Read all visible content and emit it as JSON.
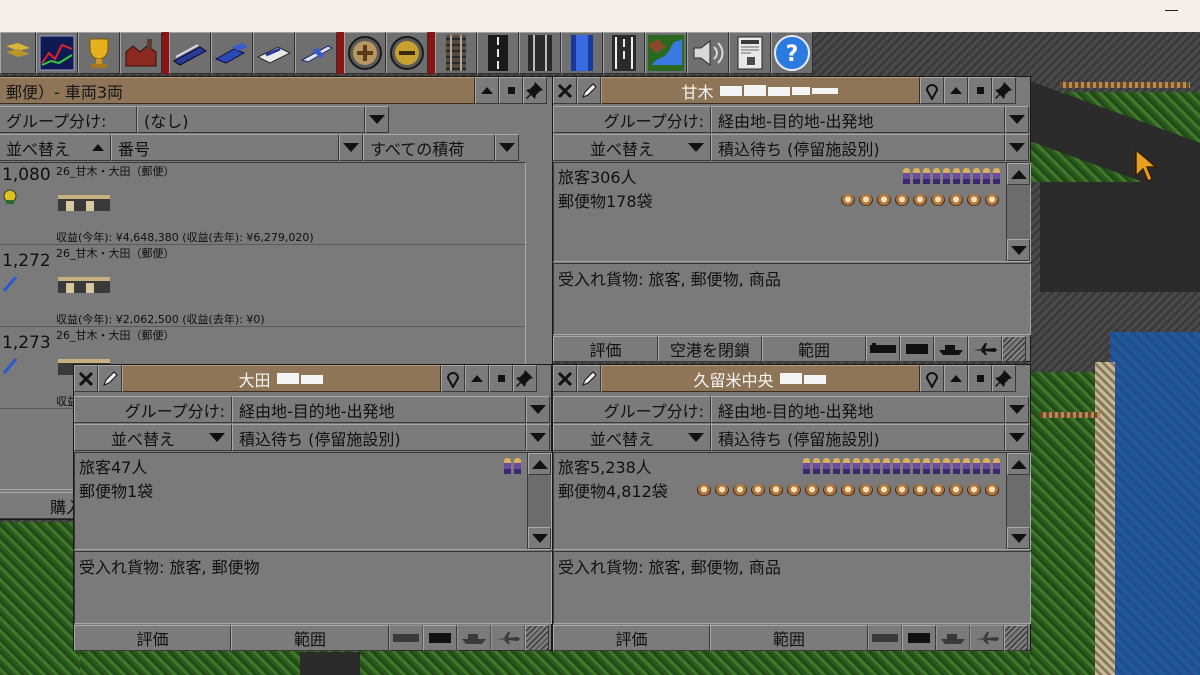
{
  "toolbar": {
    "buttons": [
      "flag-icon",
      "graph-icon",
      "trophy-icon",
      "factory-icon",
      "train-icon",
      "truck-icon",
      "ship-icon",
      "plane-icon",
      "zoom-in-icon",
      "zoom-out-icon",
      "rail-icon",
      "road-icon",
      "tram-icon",
      "water-icon",
      "airport-icon",
      "landscape-icon",
      "sound-icon",
      "newspaper-icon",
      "help-icon"
    ]
  },
  "vehicle_list_window": {
    "title": "郵便）- 車両3両",
    "group_label": "グループ分け:",
    "group_value": "(なし)",
    "sort_label": "並べ替え",
    "sort_value": "番号",
    "cargo_filter": "すべての積荷",
    "buy_button": "購入",
    "vehicles": [
      {
        "number": "1,080",
        "order": "26_甘木・大田（郵便）",
        "profit": "収益(今年): ¥4,648,380 (収益(去年): ¥6,279,020)"
      },
      {
        "number": "1,272",
        "order": "26_甘木・大田（郵便）",
        "profit": "収益(今年): ¥2,062,500 (収益(去年): ¥0)"
      },
      {
        "number": "1,273",
        "order": "26_甘木・大田（郵便）",
        "profit": "収益"
      }
    ]
  },
  "station_amagi": {
    "name": "甘木",
    "group_label": "グループ分け:",
    "group_value": "経由地-目的地-出発地",
    "sort_label": "並べ替え",
    "sort_value": "積込待ち (停留施設別)",
    "cargo": [
      {
        "text": "旅客306人",
        "icon": "passenger-icon",
        "count": 10
      },
      {
        "text": "郵便物178袋",
        "icon": "mailbag-icon",
        "count": 9
      }
    ],
    "accepts": "受入れ貨物: 旅客, 郵便物, 商品",
    "rating_button": "評価",
    "close_airport_button": "空港を閉鎖",
    "coverage_button": "範囲"
  },
  "station_ota": {
    "name": "大田",
    "group_label": "グループ分け:",
    "group_value": "経由地-目的地-出発地",
    "sort_label": "並べ替え",
    "sort_value": "積込待ち (停留施設別)",
    "cargo": [
      {
        "text": "旅客47人",
        "icon": "passenger-icon",
        "count": 2
      },
      {
        "text": "郵便物1袋",
        "icon": "mailbag-icon",
        "count": 0
      }
    ],
    "accepts": "受入れ貨物: 旅客, 郵便物",
    "rating_button": "評価",
    "coverage_button": "範囲"
  },
  "station_kurume": {
    "name": "久留米中央",
    "group_label": "グループ分け:",
    "group_value": "経由地-目的地-出発地",
    "sort_label": "並べ替え",
    "sort_value": "積込待ち (停留施設別)",
    "cargo": [
      {
        "text": "旅客5,238人",
        "icon": "passenger-icon",
        "count": 20
      },
      {
        "text": "郵便物4,812袋",
        "icon": "mailbag-icon",
        "count": 17
      }
    ],
    "accepts": "受入れ貨物: 旅客, 郵便物, 商品",
    "rating_button": "評価",
    "coverage_button": "範囲"
  }
}
